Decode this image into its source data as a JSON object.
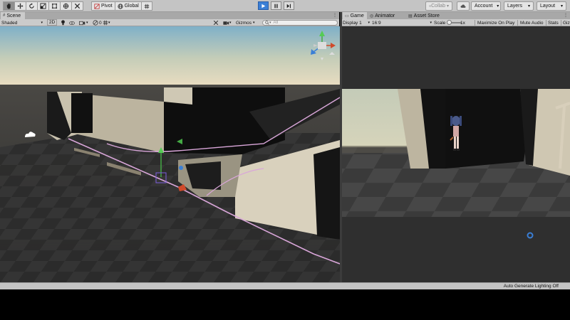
{
  "toolbar": {
    "pivot_label": "Pivot",
    "global_label": "Global",
    "collab_label": "Collab",
    "account_label": "Account",
    "layers_label": "Layers",
    "layout_label": "Layout"
  },
  "scene": {
    "tab_label": "Scene",
    "shading_label": "Shaded",
    "mode_2d_label": "2D",
    "hidden_count": "0",
    "gizmos_label": "Gizmos",
    "search_placeholder": "All"
  },
  "game": {
    "tabs": [
      {
        "label": "Game"
      },
      {
        "label": "Animator"
      },
      {
        "label": "Asset Store"
      }
    ],
    "display_label": "Display 1",
    "aspect_label": "16:9",
    "scale_label": "Scale",
    "scale_value": "1x",
    "maximize_label": "Maximize On Play",
    "mute_label": "Mute Audio",
    "stats_label": "Stats",
    "gizmos_label": "Giz"
  },
  "status": {
    "text": "Auto Generate Lighting Off"
  },
  "colors": {
    "toolbar_bg": "#c4c4c4",
    "play_active": "#3a7fd6",
    "path_line": "#d9a6d9"
  }
}
